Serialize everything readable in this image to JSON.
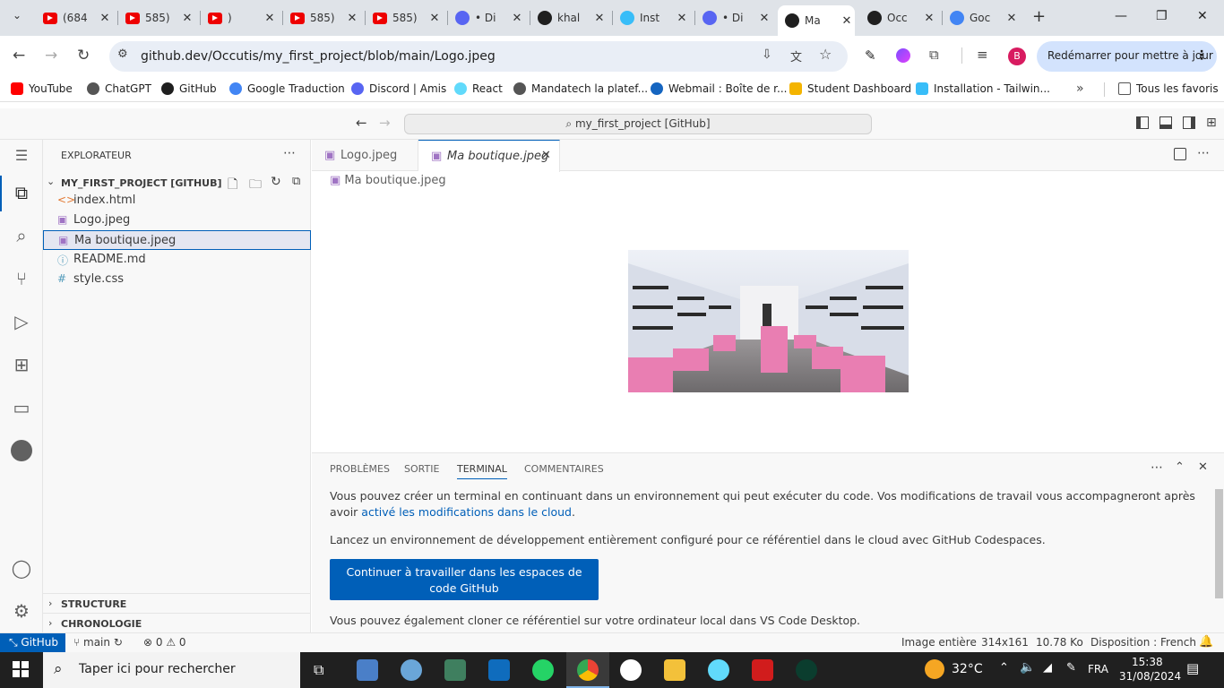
{
  "browser": {
    "tabs": [
      {
        "title": "(684",
        "icon": "youtube-icon",
        "color": "#ff0000"
      },
      {
        "title": "585)",
        "icon": "youtube-icon",
        "color": "#ff0000"
      },
      {
        "title": ")",
        "icon": "youtube-icon",
        "color": "#ff0000",
        "audio": true
      },
      {
        "title": "585)",
        "icon": "youtube-icon",
        "color": "#ff0000"
      },
      {
        "title": "585)",
        "icon": "youtube-icon",
        "color": "#ff0000"
      },
      {
        "title": "• Di",
        "icon": "discord-icon",
        "color": "#5865f2"
      },
      {
        "title": "khal",
        "icon": "github-icon",
        "color": "#1f1f1f"
      },
      {
        "title": "Inst",
        "icon": "tailwind-icon",
        "color": "#38bdf8"
      },
      {
        "title": "• Di",
        "icon": "discord-icon",
        "color": "#5865f2"
      },
      {
        "title": "Ma",
        "icon": "github-icon",
        "color": "#1f1f1f",
        "active": true
      },
      {
        "title": "Occ",
        "icon": "github-icon",
        "color": "#1f1f1f"
      },
      {
        "title": "Goc",
        "icon": "google-translate-icon",
        "color": "#4285f4"
      }
    ],
    "new_tab": "+",
    "url": "github.dev/Occutis/my_first_project/blob/main/Logo.jpeg",
    "profile_initial": "B",
    "update_button": "Redémarrer pour mettre à jour",
    "bookmarks": [
      {
        "label": "YouTube",
        "icon": "youtube-icon",
        "color": "#ff0000"
      },
      {
        "label": "ChatGPT",
        "icon": "chatgpt-icon",
        "color": "#555555"
      },
      {
        "label": "GitHub",
        "icon": "github-icon",
        "color": "#1f1f1f"
      },
      {
        "label": "Google Traduction",
        "icon": "google-translate-icon",
        "color": "#4285f4"
      },
      {
        "label": "Discord | Amis",
        "icon": "discord-icon",
        "color": "#5865f2"
      },
      {
        "label": "React",
        "icon": "react-icon",
        "color": "#61dafb"
      },
      {
        "label": "Mandatech la platef...",
        "icon": "globe-icon",
        "color": "#555555"
      },
      {
        "label": "Webmail : Boîte de r...",
        "icon": "webmail-icon",
        "color": "#1565c0"
      },
      {
        "label": "Student Dashboard",
        "icon": "student-icon",
        "color": "#f4b400"
      },
      {
        "label": "Installation - Tailwin...",
        "icon": "tailwind-icon",
        "color": "#38bdf8"
      }
    ],
    "all_bookmarks": "Tous les favoris"
  },
  "vscode": {
    "command_center": "my_first_project [GitHub]",
    "explorer_title": "EXPLORATEUR",
    "project": "MY_FIRST_PROJECT [GITHUB]",
    "files": [
      {
        "name": "index.html",
        "icon": "<>",
        "color": "#e37933"
      },
      {
        "name": "Logo.jpeg",
        "icon": "▣",
        "color": "#a074c4"
      },
      {
        "name": "Ma boutique.jpeg",
        "icon": "▣",
        "color": "#a074c4",
        "selected": true
      },
      {
        "name": "README.md",
        "icon": "ⓘ",
        "color": "#519aba"
      },
      {
        "name": "style.css",
        "icon": "#",
        "color": "#519aba"
      }
    ],
    "outline": "STRUCTURE",
    "timeline": "CHRONOLOGIE",
    "editor_tabs": [
      {
        "label": "Logo.jpeg",
        "active": false
      },
      {
        "label": "Ma boutique.jpeg",
        "active": true
      }
    ],
    "breadcrumb": "Ma boutique.jpeg",
    "panel_tabs": [
      "PROBLÈMES",
      "SORTIE",
      "TERMINAL",
      "COMMENTAIRES"
    ],
    "active_panel_tab": "TERMINAL",
    "panel_text1": "Vous pouvez créer un terminal en continuant dans un environnement qui peut exécuter du code. Vos modifications de travail vous accompagneront après avoir ",
    "panel_link": "activé les modifications dans le cloud",
    "panel_text1_end": ".",
    "panel_text2": "Lancez un environnement de développement entièrement configuré pour ce référentiel dans le cloud avec GitHub Codespaces.",
    "codespaces_button": "Continuer à travailler dans les espaces de code GitHub",
    "panel_text3": "Vous pouvez également cloner ce référentiel sur votre ordinateur local dans VS Code Desktop.",
    "status": {
      "remote": "GitHub",
      "branch": "main",
      "errors": "0",
      "warnings": "0",
      "zoom": "Image entière",
      "dimensions": "314x161",
      "size": "10.78 Ko",
      "layout": "Disposition : French"
    }
  },
  "taskbar": {
    "search_placeholder": "Taper ici pour rechercher",
    "weather": "32°C",
    "language": "FRA",
    "time": "15:38",
    "date": "31/08/2024"
  }
}
